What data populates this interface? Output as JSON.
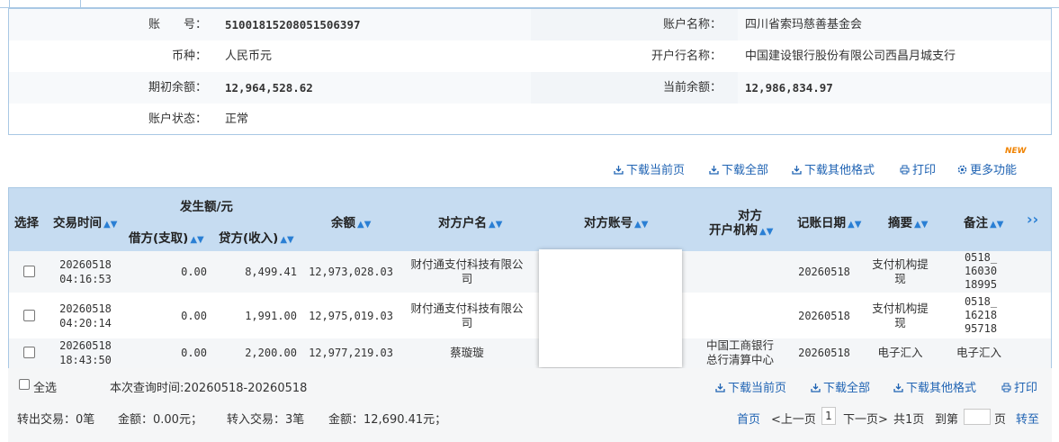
{
  "account": {
    "no_label": "账　　号：",
    "no_value": "51001815208051506397",
    "name_label": "账户名称：",
    "name_value": "四川省索玛慈善基金会",
    "currency_label": "币种：",
    "currency_value": "人民币元",
    "bank_label": "开户行名称：",
    "bank_value": "中国建设银行股份有限公司西昌月城支行",
    "opening_label": "期初余额：",
    "opening_value": "12,964,528.62",
    "current_label": "当前余额：",
    "current_value": "12,986,834.97",
    "status_label": "账户状态：",
    "status_value": "正常"
  },
  "toolbar": {
    "download_page": "下载当前页",
    "download_all": "下载全部",
    "download_other": "下载其他格式",
    "print": "打印",
    "more": "更多功能",
    "new_badge": "NEW"
  },
  "table": {
    "headers": {
      "select": "选择",
      "time": "交易时间",
      "amount_group": "发生额/元",
      "debit": "借方(支取)",
      "credit": "贷方(收入)",
      "balance": "余额",
      "counterparty_name": "对方户名",
      "counterparty_account": "对方账号",
      "counterparty_bank_l1": "对方",
      "counterparty_bank_l2": "开户机构",
      "post_date": "记账日期",
      "summary": "摘要",
      "remark": "备注"
    },
    "rows": [
      {
        "date": "20260518",
        "time": "04:16:53",
        "debit": "0.00",
        "credit": "8,499.41",
        "balance": "12,973,028.03",
        "name_l1": "财付通支付科技有限公",
        "name_l2": "司",
        "bank_l1": "",
        "bank_l2": "",
        "post_date": "20260518",
        "summary_l1": "支付机构提",
        "summary_l2": "现",
        "remark_l1": "0518_",
        "remark_l2": "16030",
        "remark_l3": "18995"
      },
      {
        "date": "20260518",
        "time": "04:20:14",
        "debit": "0.00",
        "credit": "1,991.00",
        "balance": "12,975,019.03",
        "name_l1": "财付通支付科技有限公",
        "name_l2": "司",
        "bank_l1": "",
        "bank_l2": "",
        "post_date": "20260518",
        "summary_l1": "支付机构提",
        "summary_l2": "现",
        "remark_l1": "0518_",
        "remark_l2": "16218",
        "remark_l3": "95718"
      },
      {
        "date": "20260518",
        "time": "18:43:50",
        "debit": "0.00",
        "credit": "2,200.00",
        "balance": "12,977,219.03",
        "name_l1": "蔡璇璇",
        "name_l2": "",
        "bank_l1": "中国工商银行",
        "bank_l2": "总行清算中心",
        "post_date": "20260518",
        "summary_l1": "电子汇入",
        "summary_l2": "",
        "remark_l1": "电子汇入",
        "remark_l2": "",
        "remark_l3": ""
      }
    ]
  },
  "footer": {
    "select_all": "全选",
    "query_time": "本次查询时间:20260518-20260518",
    "download_page": "下载当前页",
    "download_all": "下载全部",
    "download_other": "下载其他格式",
    "print": "打印",
    "out_count": "转出交易：0笔",
    "out_amount": "金额：0.00元；",
    "in_count": "转入交易：3笔",
    "in_amount": "金额：12,690.41元；",
    "first": "首页",
    "prev": "<上一页",
    "current_page": "1",
    "next": "下一页>",
    "total": "共1页",
    "goto": "到第",
    "page_unit": "页",
    "go": "转至"
  },
  "colors": {
    "header_bg": "#c6dcf1",
    "link": "#1f63b3",
    "border": "#a9c8e4",
    "badge": "#f08300"
  }
}
